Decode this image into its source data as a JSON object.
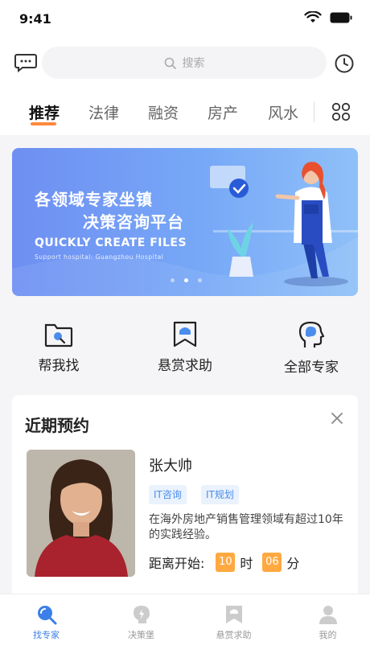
{
  "status_bar": {
    "time": "9:41"
  },
  "search": {
    "placeholder": "搜索"
  },
  "tabs": [
    "推荐",
    "法律",
    "融资",
    "房产",
    "风水"
  ],
  "banner": {
    "title_line1": "各领域专家坐镇",
    "title_line2": "决策咨询平台",
    "subtitle": "QUICKLY CREATE FILES",
    "small_text": "Support hospital: Guangzhou Hospital",
    "active_dot": 1
  },
  "shortcuts": [
    {
      "label": "帮我找",
      "icon": "folder-search-icon"
    },
    {
      "label": "悬赏求助",
      "icon": "bookmark-reward-icon"
    },
    {
      "label": "全部专家",
      "icon": "head-brain-icon"
    }
  ],
  "recent": {
    "title": "近期预约",
    "expert": {
      "name": "张大帅",
      "tags": [
        "IT咨询",
        "IT规划"
      ],
      "description": "在海外房地产销售管理领域有超过10年的实践经验。",
      "countdown_label": "距离开始:",
      "hours": "10",
      "hours_unit": "时",
      "minutes": "06",
      "minutes_unit": "分"
    }
  },
  "tabbar": [
    {
      "label": "找专家",
      "active": true
    },
    {
      "label": "决策堡",
      "active": false
    },
    {
      "label": "悬赏求助",
      "active": false
    },
    {
      "label": "我的",
      "active": false
    }
  ],
  "colors": {
    "accent": "#3c7fe8",
    "orange": "#ffa940",
    "tab_underline": "#ff8a3d"
  }
}
